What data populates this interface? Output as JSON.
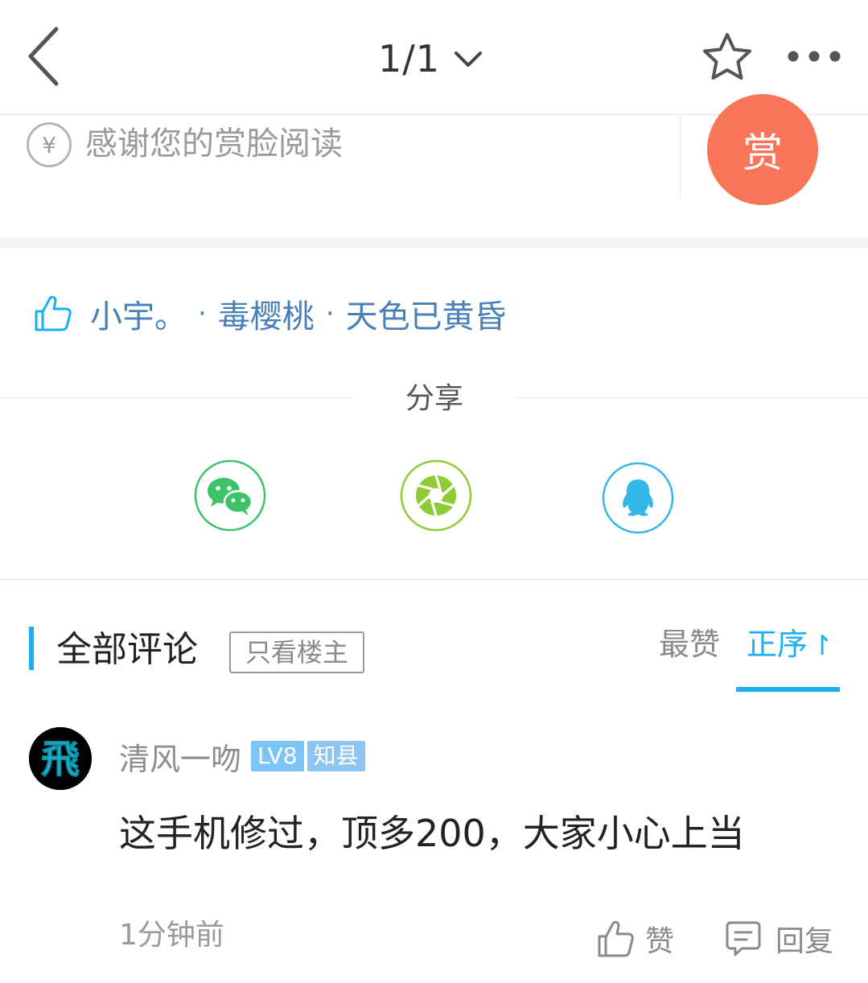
{
  "topbar": {
    "page_indicator": "1/1",
    "icons": [
      "back-arrow-icon",
      "chevron-down-icon",
      "star-icon",
      "more-dots-icon"
    ]
  },
  "reward": {
    "prompt": "感谢您的赏脸阅读",
    "button_label": "赏",
    "currency_symbol": "¥",
    "accent_color": "#f97558"
  },
  "likes": {
    "users": [
      "小宇。",
      "毒樱桃",
      "天色已黄昏"
    ],
    "separator": "·",
    "link_color": "#4a80b8"
  },
  "share": {
    "title": "分享",
    "targets": [
      "wechat-icon",
      "moments-icon",
      "qq-icon"
    ]
  },
  "comments": {
    "title": "全部评论",
    "owner_only_label": "只看楼主",
    "sort_top_label": "最赞",
    "sort_asc_label": "正序",
    "sort_asc_arrow": "↾",
    "accent_color": "#1ab0f0",
    "items": [
      {
        "user": "清风一吻",
        "level": "LV8",
        "title": "知县",
        "avatar_glyph": "飛",
        "body": "这手机修过，顶多200，大家小心上当",
        "time": "1分钟前",
        "like_label": "赞",
        "reply_label": "回复"
      }
    ]
  }
}
